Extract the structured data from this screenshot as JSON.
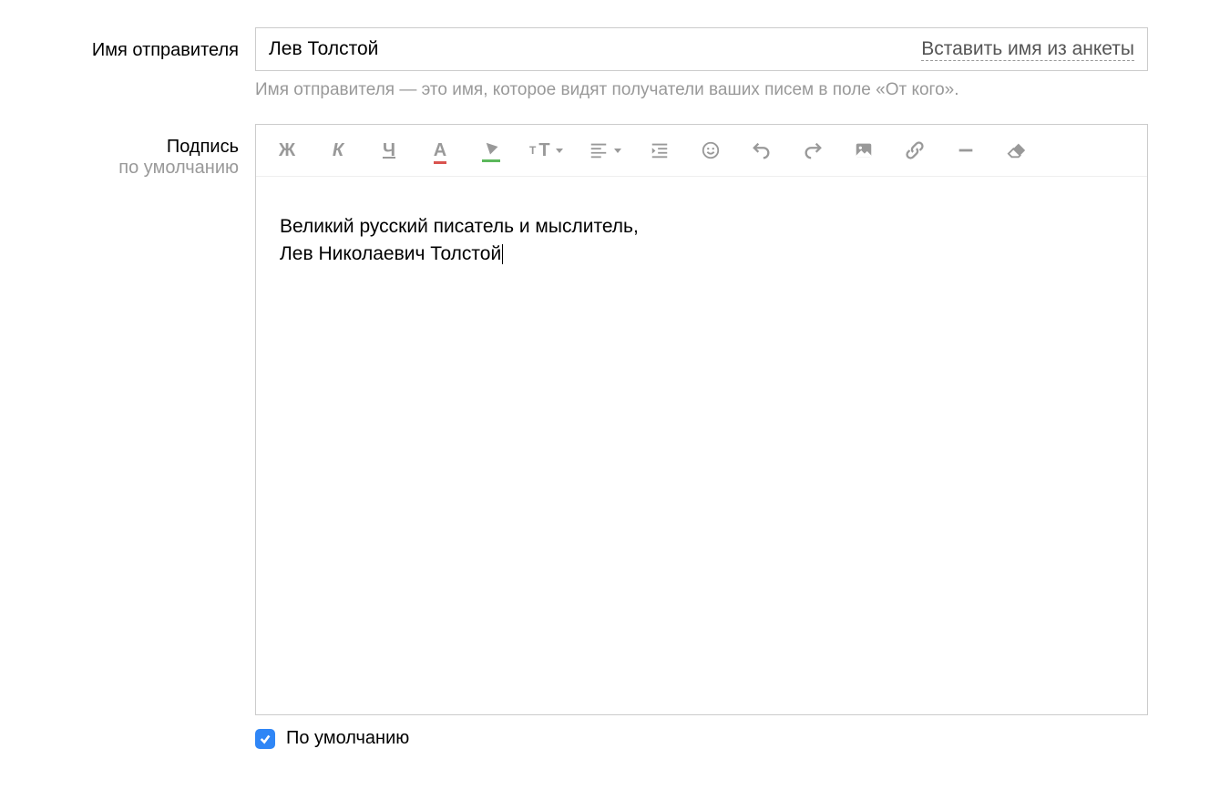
{
  "sender_name": {
    "label": "Имя отправителя",
    "value": "Лев Толстой",
    "insert_link": "Вставить имя из анкеты",
    "hint": "Имя отправителя — это имя, которое видят получатели ваших писем в поле «От кого»."
  },
  "signature": {
    "label_line1": "Подпись",
    "label_line2": "по умолчанию",
    "content_line1": "Великий русский писатель и мыслитель,",
    "content_line2": "Лев Николаевич Толстой"
  },
  "toolbar": {
    "bold": "Ж",
    "italic": "К",
    "underline": "Ч",
    "text_color": "А",
    "font_size_small": "T",
    "font_size_big": "T"
  },
  "default_checkbox": {
    "label": "По умолчанию",
    "checked": true
  }
}
